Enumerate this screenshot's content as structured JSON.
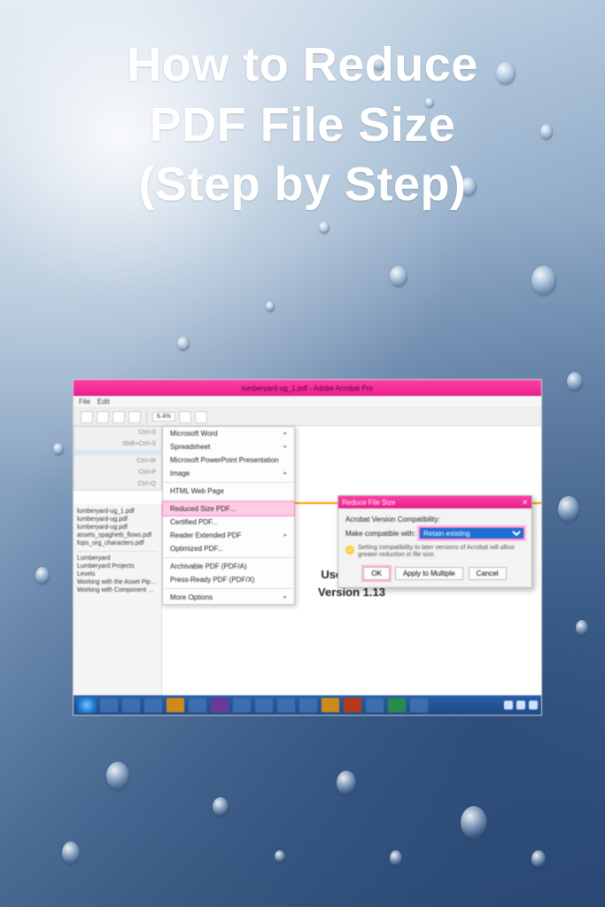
{
  "headline": {
    "line1": "How to Reduce",
    "line2": "PDF File Size",
    "line3": "(Step by Step)"
  },
  "app": {
    "title_text": "lumberyard-ug_1.pdf - Adobe Acrobat Pro",
    "menubar": {
      "file": "File",
      "edit": "Edit"
    },
    "toolbar": {
      "zoom": "6.4%"
    }
  },
  "file_menu": {
    "items": [
      {
        "label": "",
        "shortcut": "Ctrl+S"
      },
      {
        "label": "",
        "shortcut": "Shift+Ctrl+S"
      },
      {
        "label": "",
        "shortcut": "Ctrl+W"
      },
      {
        "label": "",
        "shortcut": "Ctrl+P"
      },
      {
        "label": "",
        "shortcut": "Ctrl+Q"
      }
    ]
  },
  "saveas_submenu": {
    "items": [
      "Microsoft Word",
      "Spreadsheet",
      "Microsoft PowerPoint Presentation",
      "Image",
      "HTML Web Page",
      "Reduced Size PDF...",
      "Certified PDF...",
      "Reader Extended PDF",
      "Optimized PDF...",
      "Archivable PDF (PDF/A)",
      "Press-Ready PDF (PDF/X)",
      "More Options"
    ],
    "selected_index": 5
  },
  "sidepanel": {
    "recent": [
      "lumberyard-ug_1.pdf",
      "lumberyard-ug.pdf",
      "lumberyard-ug.pdf",
      "assets_spaghetti_flows.pdf",
      "fops_org_characters.pdf"
    ],
    "bookmarks": [
      "Lumberyard",
      "Lumberyard Projects",
      "Levels",
      "Working with the Asset Pipeline and Files",
      "Working with Component Entities"
    ]
  },
  "document": {
    "title": "User Guide",
    "version": "Version 1.13"
  },
  "dialog": {
    "title": "Reduce File Size",
    "section_label": "Acrobat Version Compatibility:",
    "field_label": "Make compatible with:",
    "dropdown_value": "Retain existing",
    "note": "Setting compatibility to later versions of Acrobat will allow greater reduction in file size.",
    "buttons": {
      "ok": "OK",
      "apply": "Apply to Multiple",
      "cancel": "Cancel"
    },
    "close_glyph": "✕"
  }
}
